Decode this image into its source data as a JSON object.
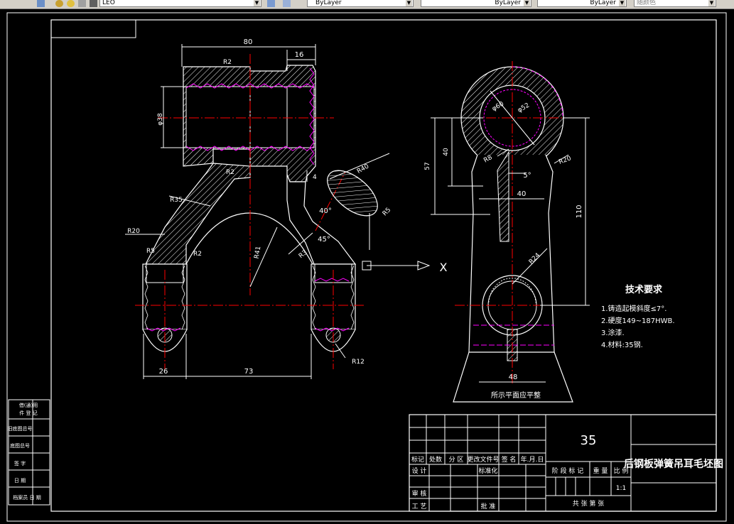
{
  "toolbar": {
    "layer_name": "LEO",
    "color_value": "ByLayer",
    "linetype_value": "ByLayer",
    "lineweight_value": "ByLayer",
    "plotstyle_value": "随颜色"
  },
  "dimensions": {
    "d80": "80",
    "d16": "16",
    "r2_top": "R2",
    "d38": "φ38",
    "r2_mid": "R2",
    "d4": "4",
    "r35": "R35",
    "r20_left": "R20",
    "r5_left": "R5",
    "r2_low": "R2",
    "r41": "R41",
    "r3": "R3",
    "a40": "40°",
    "a45": "45°",
    "r40": "R40",
    "r5_right": "R5",
    "r12": "R12",
    "d26": "26",
    "d73": "73",
    "d57": "57",
    "d40v": "40",
    "d60": "φ60",
    "d52": "φ52",
    "r8": "R8",
    "a5": "5°",
    "r20_right": "R20",
    "d40h": "40",
    "d110": "110",
    "r24": "R24",
    "d48": "48",
    "section_x": "X"
  },
  "notes": {
    "flat_note": "所示平面应平整",
    "tech_title": "技术要求",
    "tech_items": [
      "1.铸造起模斜度≤7°.",
      "2.硬度149~187HWB.",
      "3.涂漆.",
      "4.材料:35钢."
    ]
  },
  "side_table": {
    "rows": [
      "借(通)用",
      "件 登 记",
      "旧底图总号",
      "底图总号",
      "签 字",
      "日 期",
      "档案员  日 期"
    ]
  },
  "title_block": {
    "material": "35",
    "drawing_title": "后钢板弹簧吊耳毛坯图",
    "scale": "1:1",
    "rev_headers": [
      "标记",
      "处数",
      "分 区",
      "更改文件号",
      "签 名",
      "年.月.日"
    ],
    "row_design": "设 计",
    "row_standard": "标准化",
    "row_check": "审 核",
    "row_process": "工 艺",
    "row_approve": "批 准",
    "stage_label": "阶 段 标 记",
    "weight_label": "重 量",
    "scale_label": "比 例",
    "sheets_label": "共    张  第    张"
  }
}
